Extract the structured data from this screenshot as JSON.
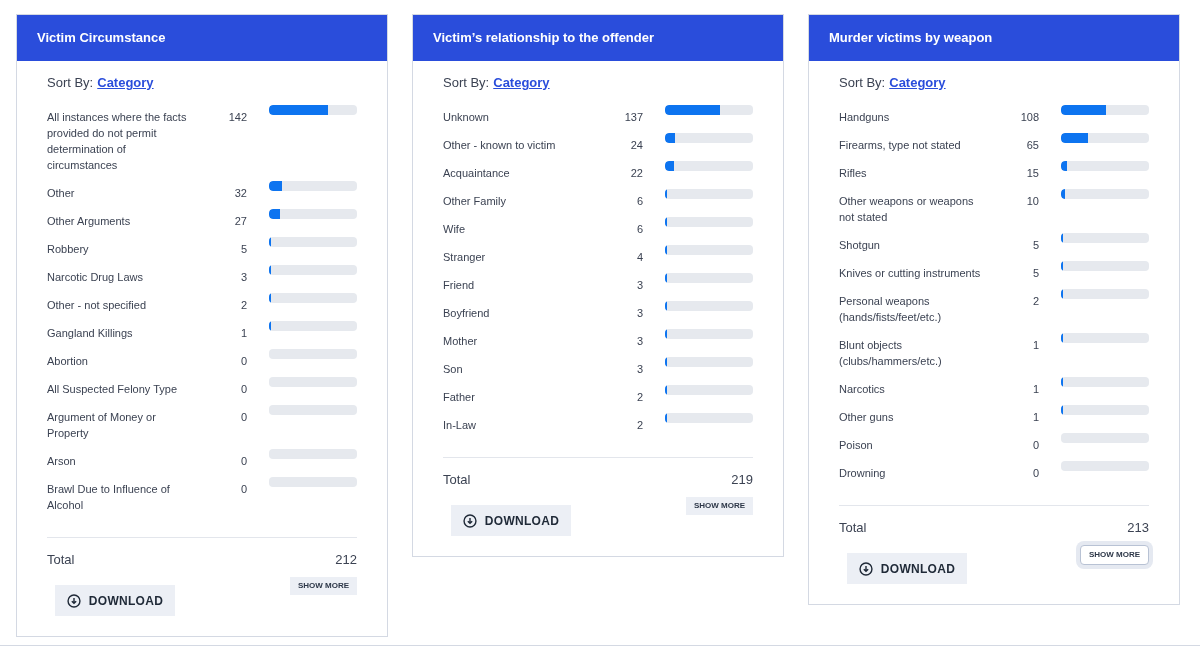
{
  "cards": [
    {
      "title": "Victim Circumstance",
      "sort_label": "Sort By:",
      "sort_value": "Category",
      "rows": [
        {
          "label": "All instances where the facts provided do not permit determination of circumstances",
          "count": "142",
          "level": 0.67
        },
        {
          "label": "Other",
          "count": "32",
          "level": 0.15
        },
        {
          "label": "Other Arguments",
          "count": "27",
          "level": 0.13
        },
        {
          "label": "Robbery",
          "count": "5",
          "level": 0.024
        },
        {
          "label": "Narcotic Drug Laws",
          "count": "3",
          "level": 0.014
        },
        {
          "label": "Other - not specified",
          "count": "2",
          "level": 0.009
        },
        {
          "label": "Gangland Killings",
          "count": "1",
          "level": 0.005
        },
        {
          "label": "Abortion",
          "count": "0"
        },
        {
          "label": "All Suspected Felony Type",
          "count": "0"
        },
        {
          "label": "Argument of Money or Property",
          "count": "0"
        },
        {
          "label": "Arson",
          "count": "0"
        },
        {
          "label": "Brawl Due to Influence of Alcohol",
          "count": "0"
        }
      ],
      "total_label": "Total",
      "total": "212",
      "show_more": {
        "label": "SHOW MORE",
        "focused": false
      },
      "download": "DOWNLOAD"
    },
    {
      "title": "Victim’s relationship to the offender",
      "sort_label": "Sort By:",
      "sort_value": "Category",
      "rows": [
        {
          "label": "Unknown",
          "count": "137",
          "level": 0.63
        },
        {
          "label": "Other - known to victim",
          "count": "24",
          "level": 0.11
        },
        {
          "label": "Acquaintance",
          "count": "22",
          "level": 0.1
        },
        {
          "label": "Other Family",
          "count": "6",
          "level": 0.027
        },
        {
          "label": "Wife",
          "count": "6",
          "level": 0.027
        },
        {
          "label": "Stranger",
          "count": "4",
          "level": 0.018
        },
        {
          "label": "Friend",
          "count": "3",
          "level": 0.014
        },
        {
          "label": "Boyfriend",
          "count": "3",
          "level": 0.014
        },
        {
          "label": "Mother",
          "count": "3",
          "level": 0.014
        },
        {
          "label": "Son",
          "count": "3",
          "level": 0.014
        },
        {
          "label": "Father",
          "count": "2",
          "level": 0.009
        },
        {
          "label": "In-Law",
          "count": "2",
          "level": 0.009
        }
      ],
      "total_label": "Total",
      "total": "219",
      "show_more": {
        "label": "SHOW MORE",
        "focused": false
      },
      "download": "DOWNLOAD"
    },
    {
      "title": "Murder victims by weapon",
      "sort_label": "Sort By:",
      "sort_value": "Category",
      "rows": [
        {
          "label": "Handguns",
          "count": "108",
          "level": 0.51
        },
        {
          "label": "Firearms, type not stated",
          "count": "65",
          "level": 0.31
        },
        {
          "label": "Rifles",
          "count": "15",
          "level": 0.07
        },
        {
          "label": "Other weapons or weapons not stated",
          "count": "10",
          "level": 0.047
        },
        {
          "label": "Shotgun",
          "count": "5",
          "level": 0.023
        },
        {
          "label": "Knives or cutting instruments",
          "count": "5",
          "level": 0.023
        },
        {
          "label": "Personal weapons (hands/fists/feet/etc.)",
          "count": "2",
          "level": 0.009
        },
        {
          "label": "Blunt objects (clubs/hammers/etc.)",
          "count": "1",
          "level": 0.005
        },
        {
          "label": "Narcotics",
          "count": "1",
          "level": 0.005
        },
        {
          "label": "Other guns",
          "count": "1",
          "level": 0.005
        },
        {
          "label": "Poison",
          "count": "0"
        },
        {
          "label": "Drowning",
          "count": "0"
        }
      ],
      "total_label": "Total",
      "total": "213",
      "show_more": {
        "label": "SHOW MORE",
        "focused": true
      },
      "download": "DOWNLOAD"
    }
  ]
}
